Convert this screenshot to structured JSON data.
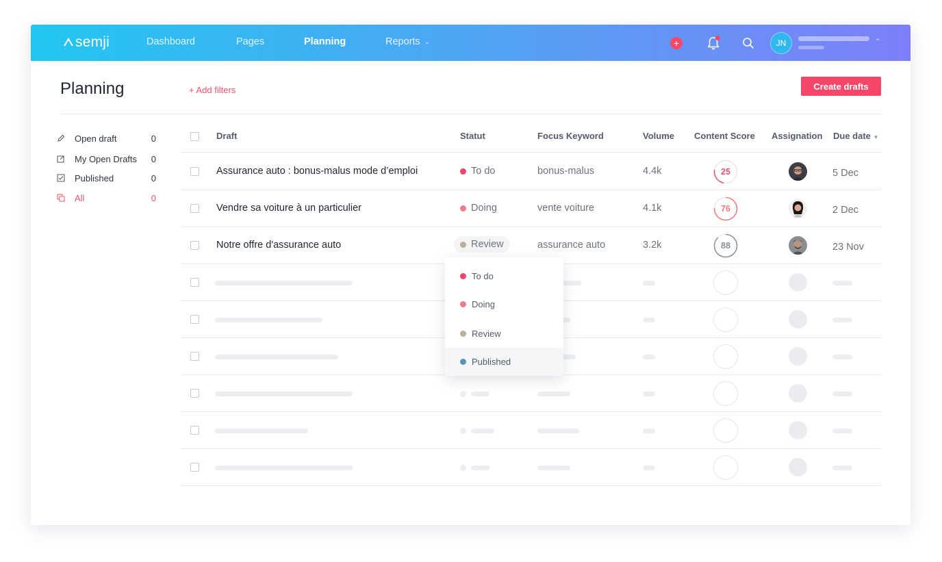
{
  "nav": {
    "logo": "semji",
    "items": [
      "Dashboard",
      "Pages",
      "Planning",
      "Reports"
    ],
    "active": "Planning",
    "add_icon": "+",
    "user_initials": "JN"
  },
  "page": {
    "title": "Planning",
    "add_filters": "+ Add filters",
    "create_button": "Create drafts"
  },
  "sidebar": {
    "items": [
      {
        "label": "Open draft",
        "count": "0",
        "icon": "pencil-icon"
      },
      {
        "label": "My Open Drafts",
        "count": "0",
        "icon": "edit-icon"
      },
      {
        "label": "Published",
        "count": "0",
        "icon": "checkbox-icon"
      },
      {
        "label": "All",
        "count": "0",
        "icon": "copy-icon"
      }
    ]
  },
  "table": {
    "columns": [
      "Draft",
      "Statut",
      "Focus Keyword",
      "Volume",
      "Content Score",
      "Assignation",
      "Due date"
    ],
    "rows": [
      {
        "draft": "Assurance auto : bonus-malus mode d’emploi",
        "status": "To do",
        "keyword": "bonus-malus",
        "volume": "4.4k",
        "score": "25",
        "due": "5 Dec"
      },
      {
        "draft": "Vendre sa voiture à un particulier",
        "status": "Doing",
        "keyword": "vente voiture",
        "volume": "4.1k",
        "score": "76",
        "due": "2 Dec"
      },
      {
        "draft": "Notre offre d'assurance auto",
        "status": "Review",
        "keyword": "assurance auto",
        "volume": "3.2k",
        "score": "88",
        "due": "23 Nov"
      }
    ]
  },
  "status_menu": {
    "options": [
      "To do",
      "Doing",
      "Review",
      "Published"
    ],
    "highlighted": "Published"
  },
  "colors": {
    "accent": "#f5476a",
    "todo": "#f0456a",
    "doing": "#f07a8a",
    "review": "#b9b09a",
    "published": "#5a96b3",
    "score_low": "#f0506e",
    "score_mid": "#f07a7a",
    "score_high": "#8a9099"
  }
}
